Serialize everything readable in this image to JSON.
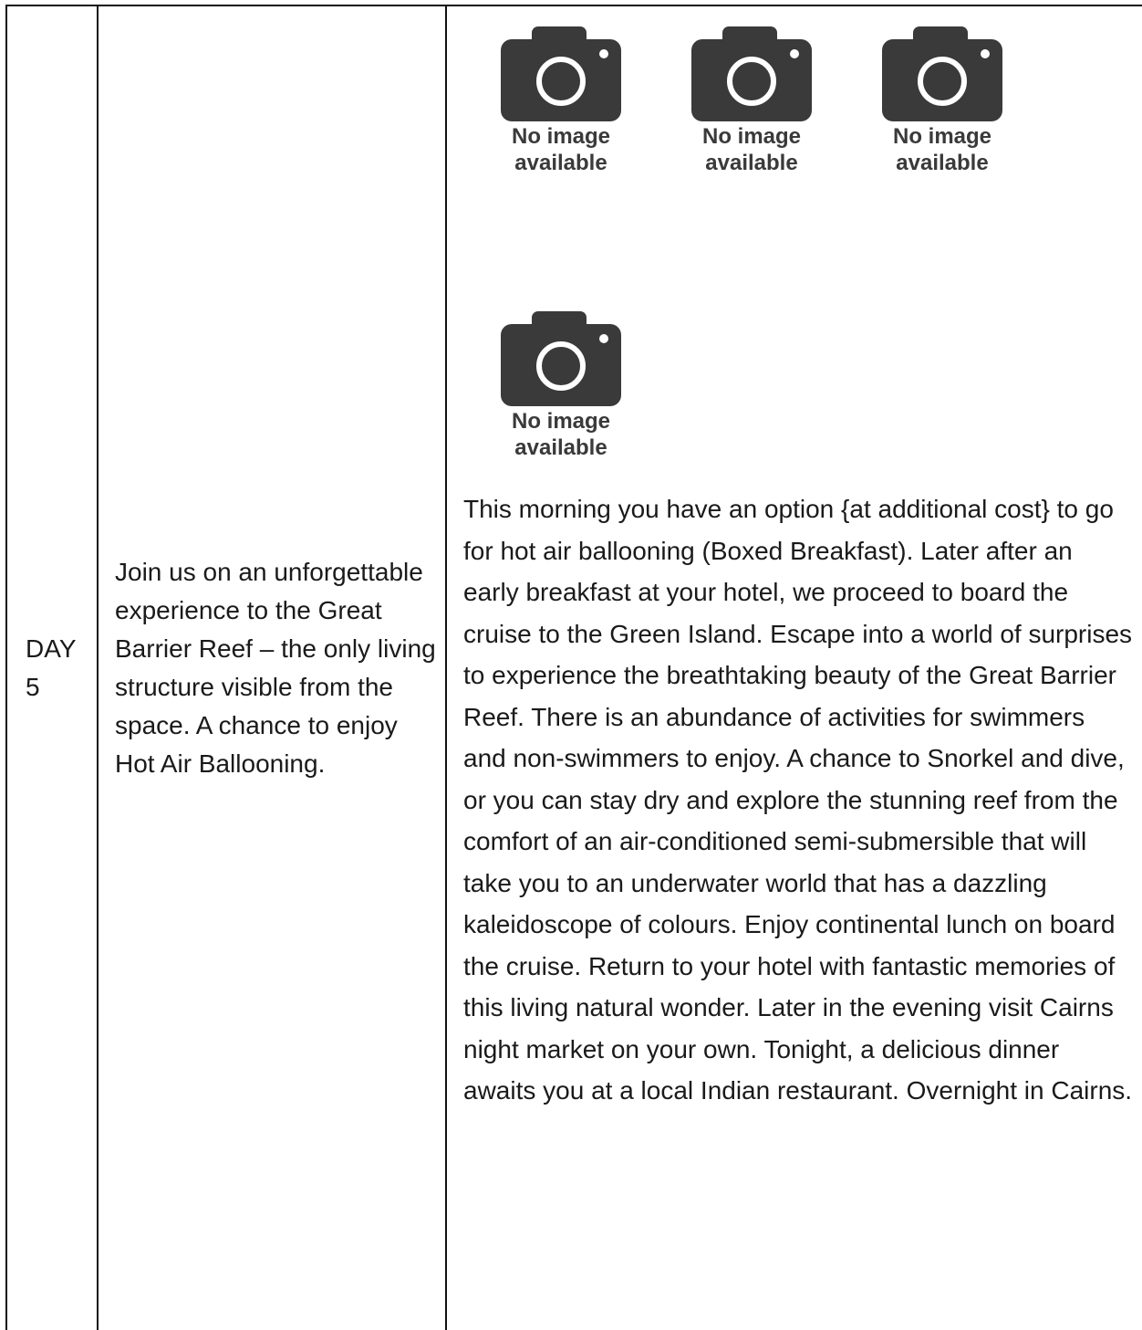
{
  "day": {
    "label": "DAY",
    "number": "5"
  },
  "summary": "Join us on an unforgettable experience to the Great Barrier Reef – the only living structure visible from the space. A chance to enjoy Hot Air Ballooning.",
  "gallery": {
    "placeholder_text_line1": "No image",
    "placeholder_text_line2": "available",
    "icon": "camera-icon",
    "count": 4
  },
  "detail": "This morning you have an option {at additional cost} to go for hot air ballooning (Boxed Breakfast). Later after an early breakfast at your hotel, we proceed to board the cruise to the Green Island. Escape into a world of surprises to experience the breathtaking beauty of the Great Barrier Reef. There is an abundance of activities for swimmers and non-swimmers to enjoy. A chance to Snorkel and dive, or you can stay dry and explore the stunning reef from the comfort of an air-conditioned semi-submersible that will take you to an underwater world that has a dazzling kaleidoscope of colours. Enjoy continental lunch on board the cruise. Return to your hotel with fantastic memories of this living natural wonder. Later in the evening visit Cairns night market on your own. Tonight, a delicious dinner awaits you at a local Indian restaurant. Overnight in Cairns.",
  "colors": {
    "border": "#111111",
    "text": "#1a1a1a",
    "camera": "#3a3a3a"
  }
}
